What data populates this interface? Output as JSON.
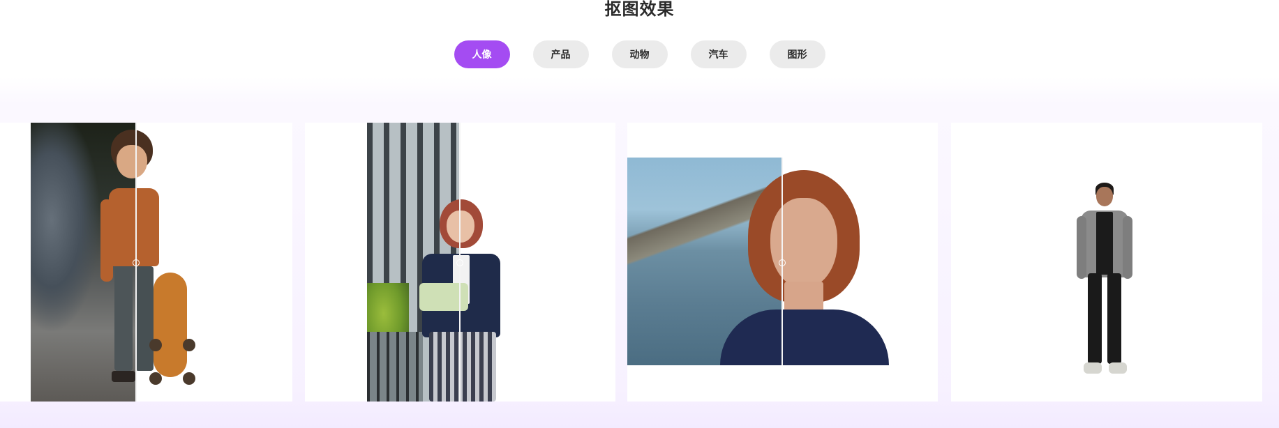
{
  "section": {
    "title": "抠图效果"
  },
  "tabs": [
    {
      "label": "人像",
      "active": true
    },
    {
      "label": "产品",
      "active": false
    },
    {
      "label": "动物",
      "active": false
    },
    {
      "label": "汽车",
      "active": false
    },
    {
      "label": "图形",
      "active": false
    }
  ],
  "colors": {
    "accent": "#a44cf2",
    "tab_inactive": "#ebebeb",
    "title_text": "#2a2a2a"
  },
  "cards": [
    {
      "subject": "boy-with-skateboard"
    },
    {
      "subject": "girl-reading-book"
    },
    {
      "subject": "woman-portrait"
    },
    {
      "subject": "man-standing"
    }
  ]
}
